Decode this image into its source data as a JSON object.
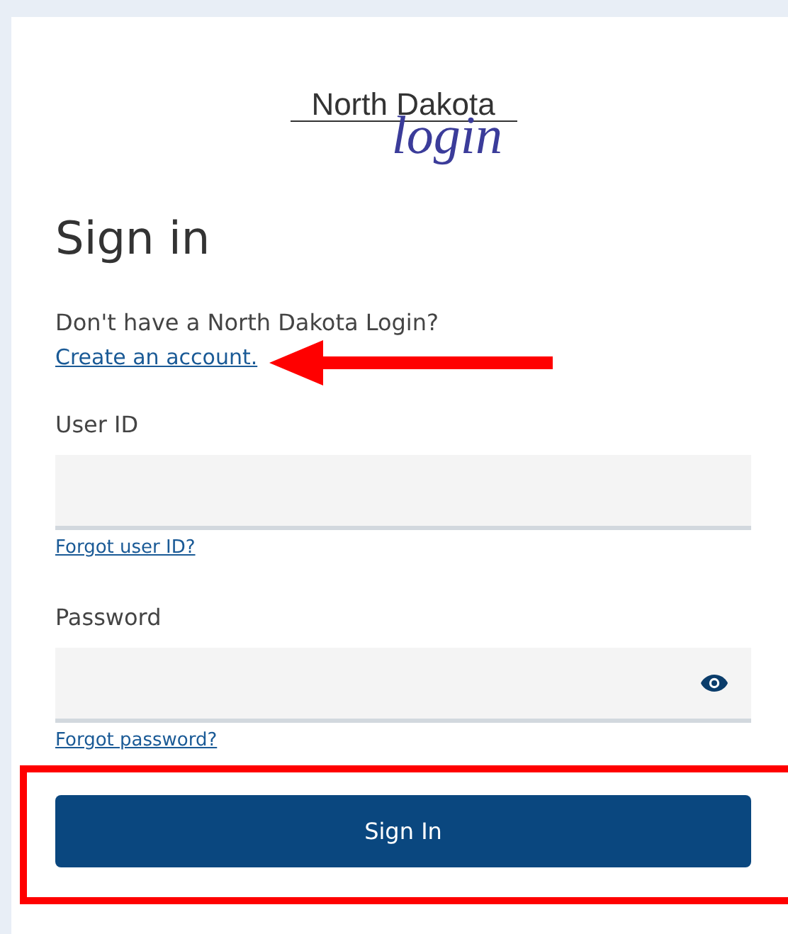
{
  "logo": {
    "line1": "North Dakota",
    "line2": "login"
  },
  "heading": "Sign in",
  "prompt": "Don't have a North Dakota Login?",
  "create_link": "Create an account.",
  "fields": [
    {
      "kind": "text",
      "label": "User ID",
      "link": "Forgot user ID?"
    },
    {
      "kind": "password",
      "label": "Password",
      "link": "Forgot password?"
    }
  ],
  "button": "Sign In",
  "arrow_annotation": true,
  "highlight_frame": true
}
